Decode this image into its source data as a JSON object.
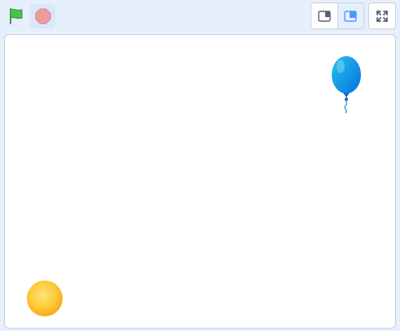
{
  "toolbar": {
    "green_flag_icon": "green-flag-icon",
    "stop_icon": "stop-icon",
    "small_stage_icon": "small-stage-icon",
    "large_stage_icon": "large-stage-icon",
    "fullscreen_icon": "fullscreen-icon",
    "selected_layout": "large-stage"
  },
  "colors": {
    "background": "#e6f0fc",
    "flag_green": "#4cbf56",
    "stop_red": "#ec9c9c",
    "accent_blue": "#4c97ff",
    "balloon_blue": "#0fa3e8",
    "ball_yellow": "#ffb81f"
  },
  "stage": {
    "sprites": [
      {
        "name": "balloon",
        "icon": "balloon-sprite"
      },
      {
        "name": "ball",
        "icon": "ball-sprite"
      }
    ]
  }
}
